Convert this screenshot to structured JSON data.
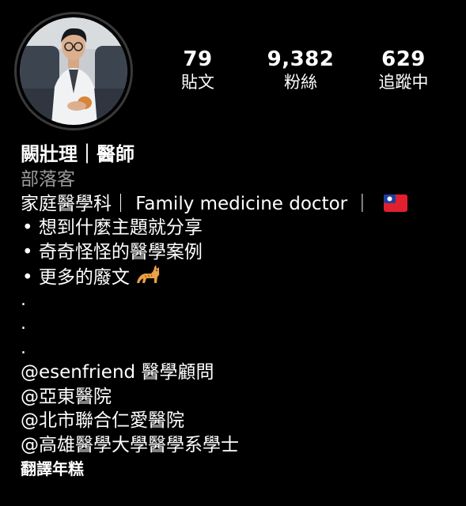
{
  "profile": {
    "avatar_icon": "avatar-photo",
    "stats": [
      {
        "count": "79",
        "label": "貼文"
      },
      {
        "count": "9,382",
        "label": "粉絲"
      },
      {
        "count": "629",
        "label": "追蹤中"
      }
    ],
    "name": "闕壯理｜醫師",
    "category": "部落客",
    "bio": {
      "headline": "家庭醫學科｜ Family medicine doctor ｜",
      "headline_icon": "taiwan-flag-icon",
      "bullets": [
        "• 想到什麼主題就分享",
        "• 奇奇怪怪的醫學案例",
        "• 更多的廢文"
      ],
      "bullet_icon": "cat-emoji-icon",
      "dots": [
        ".",
        ".",
        "."
      ],
      "mentions": [
        "@esenfriend 醫學顧問",
        "@亞東醫院",
        "@北市聯合仁愛醫院",
        "@高雄醫學大學醫學系學士"
      ]
    },
    "translate_label": "翻譯年糕"
  },
  "colors": {
    "background": "#000000",
    "text": "#ffffff",
    "category": "#9a9a9a",
    "avatar_ring": "#3a3a3a"
  }
}
